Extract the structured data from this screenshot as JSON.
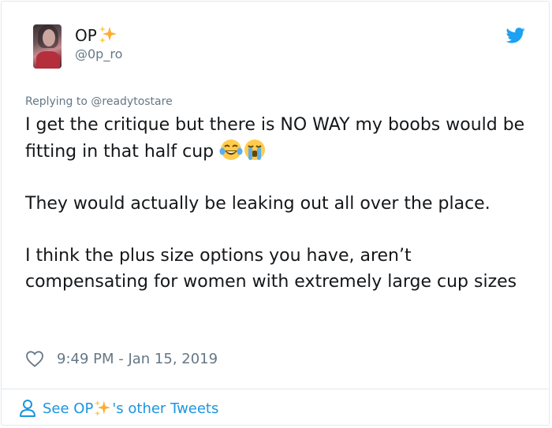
{
  "user": {
    "display_name": "OP",
    "name_emoji": "sparkles-icon",
    "handle": "@0p_ro"
  },
  "tweet": {
    "reply_prefix": "Replying to",
    "reply_to": "@readytostare",
    "paragraph_1": "I get the critique but there is NO WAY my boobs would be fitting in that half cup",
    "paragraph_1_emojis": [
      "face-with-tears-of-joy-icon",
      "loudly-crying-face-icon"
    ],
    "paragraph_2": "They would actually be leaking out all over the place.",
    "paragraph_3": "I think the plus size options you have, aren’t compensating for women with extremely large cup sizes",
    "timestamp": "9:49 PM - Jan 15, 2019"
  },
  "footer": {
    "prefix": "See OP",
    "suffix": "'s other Tweets"
  },
  "colors": {
    "text": "#14171a",
    "secondary": "#657786",
    "link": "#1b95e0",
    "twitter_blue": "#1da1f2",
    "border": "#e1e8ed"
  }
}
